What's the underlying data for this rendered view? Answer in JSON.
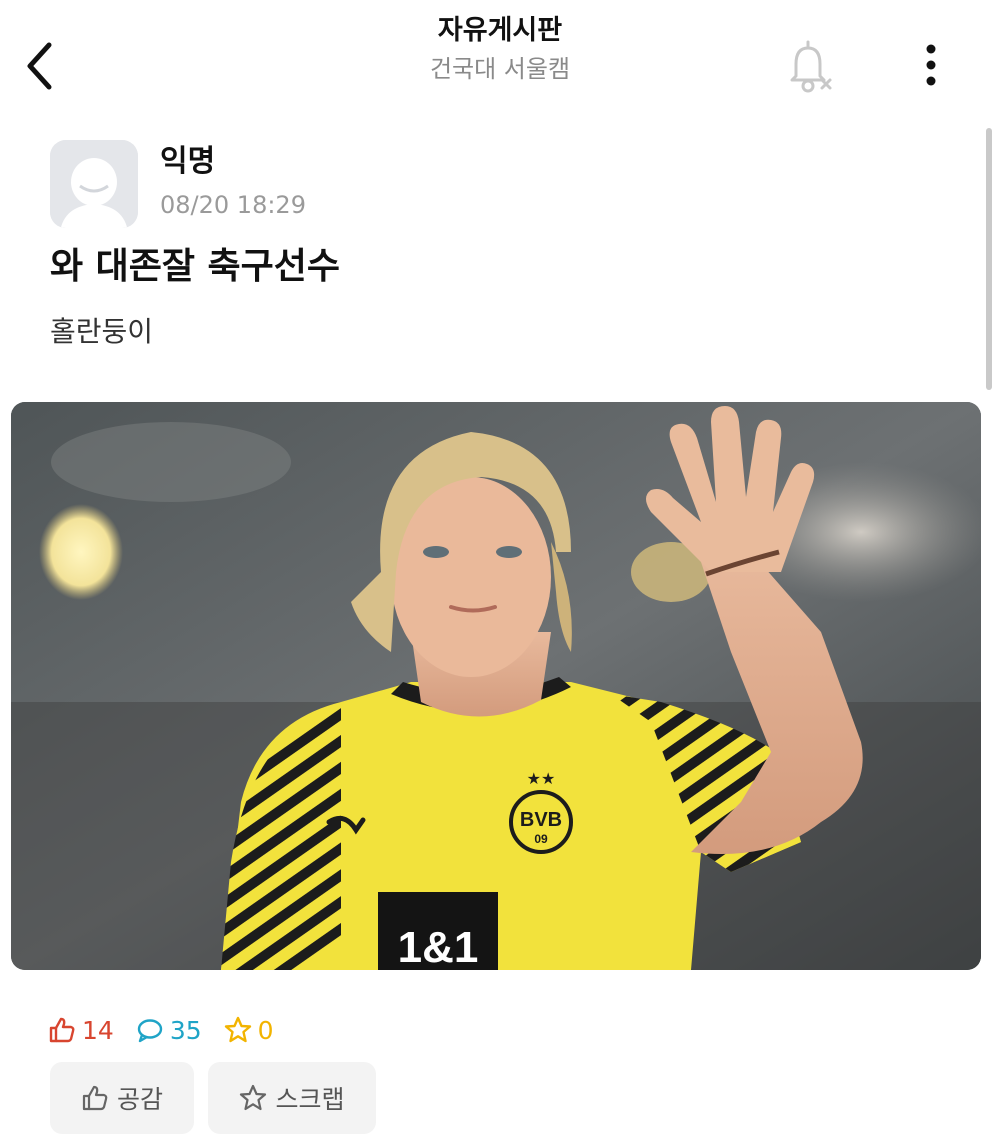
{
  "header": {
    "title": "자유게시판",
    "subtitle": "건국대 서울캠"
  },
  "post": {
    "author": "익명",
    "timestamp": "08/20 18:29",
    "title": "와 대존잘 축구선수",
    "body": "홀란둥이"
  },
  "photo": {
    "shirt_sponsor": "1&1",
    "club_badge": "BVB",
    "badge_number": "09"
  },
  "stats": {
    "likes": "14",
    "comments": "35",
    "scraps": "0"
  },
  "actions": {
    "like_label": "공감",
    "scrap_label": "스크랩"
  },
  "colors": {
    "like": "#d8452f",
    "comment": "#1fa4c7",
    "scrap": "#f2b400",
    "button_bg": "#f3f3f3"
  },
  "icons": {
    "back": "chevron-left-icon",
    "notification": "bell-off-icon",
    "more": "more-vertical-icon",
    "like": "thumbs-up-icon",
    "comment": "speech-bubble-icon",
    "scrap": "star-icon"
  }
}
